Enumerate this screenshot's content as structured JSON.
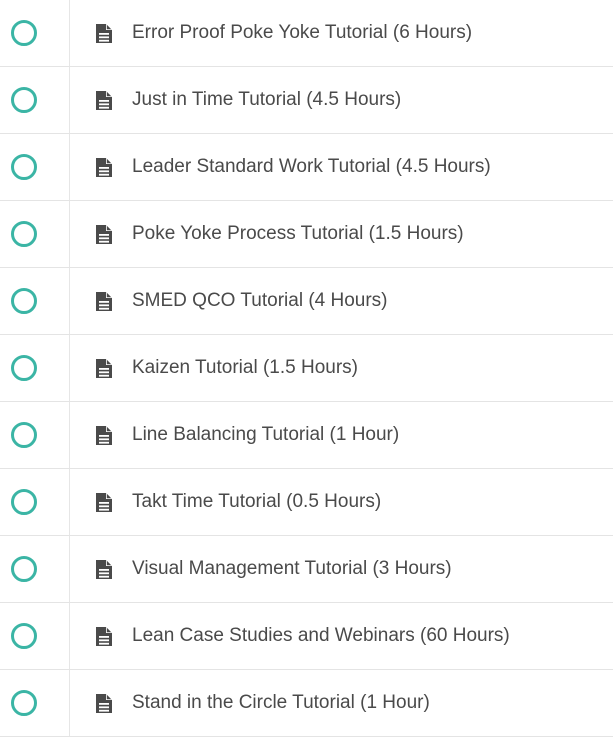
{
  "lectures": [
    {
      "title": "Error Proof Poke Yoke Tutorial (6 Hours)",
      "status_icon": "incomplete-circle-icon",
      "type_icon": "document-icon"
    },
    {
      "title": "Just in Time Tutorial (4.5 Hours)",
      "status_icon": "incomplete-circle-icon",
      "type_icon": "document-icon"
    },
    {
      "title": "Leader Standard Work Tutorial (4.5 Hours)",
      "status_icon": "incomplete-circle-icon",
      "type_icon": "document-icon"
    },
    {
      "title": "Poke Yoke Process Tutorial (1.5 Hours)",
      "status_icon": "incomplete-circle-icon",
      "type_icon": "document-icon"
    },
    {
      "title": "SMED QCO Tutorial (4 Hours)",
      "status_icon": "incomplete-circle-icon",
      "type_icon": "document-icon"
    },
    {
      "title": "Kaizen Tutorial (1.5 Hours)",
      "status_icon": "incomplete-circle-icon",
      "type_icon": "document-icon"
    },
    {
      "title": "Line Balancing Tutorial (1 Hour)",
      "status_icon": "incomplete-circle-icon",
      "type_icon": "document-icon"
    },
    {
      "title": "Takt Time Tutorial (0.5 Hours)",
      "status_icon": "incomplete-circle-icon",
      "type_icon": "document-icon"
    },
    {
      "title": "Visual Management Tutorial (3 Hours)",
      "status_icon": "incomplete-circle-icon",
      "type_icon": "document-icon"
    },
    {
      "title": "Lean Case Studies and Webinars (60 Hours)",
      "status_icon": "incomplete-circle-icon",
      "type_icon": "document-icon"
    },
    {
      "title": "Stand in the Circle Tutorial (1 Hour)",
      "status_icon": "incomplete-circle-icon",
      "type_icon": "document-icon"
    }
  ],
  "colors": {
    "status_circle": "#3bb5a5",
    "text": "#4a4a4a",
    "icon": "#4a4a4a",
    "divider": "#e4e4e4"
  }
}
